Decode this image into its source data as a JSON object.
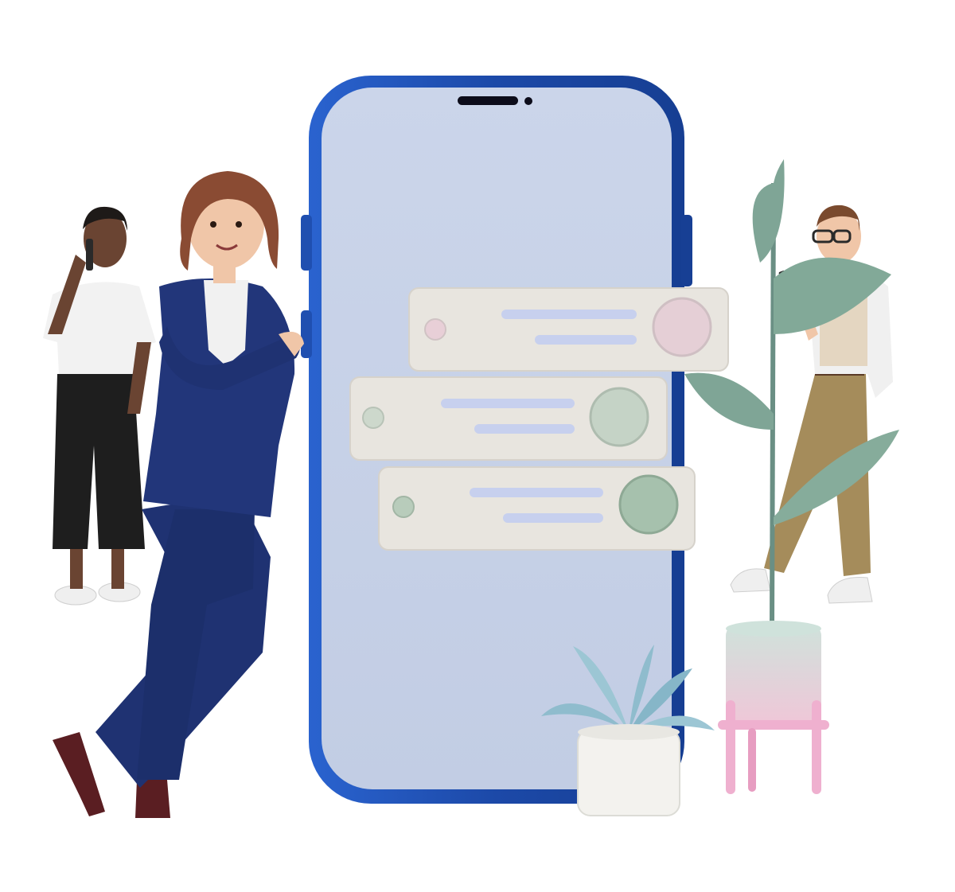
{
  "scene": {
    "description_items": [
      "phone",
      "message-cards",
      "woman-in-suit",
      "person-on-phone",
      "man-with-glasses",
      "tall-plant",
      "small-plant"
    ]
  },
  "colors": {
    "phone_frame": "#1f4fb0",
    "phone_frame_light": "#3c7ee0",
    "phone_screen": "#c8d1e6",
    "card": "#e9e6e0",
    "card_line": "#c9d2ef",
    "dot_pink": "#e6cfd6",
    "dot_sage": "#c7d3c6",
    "dot_green": "#a9c2b0",
    "suit": "#1e3170",
    "hair_brown": "#8a4b33",
    "skin_light": "#f0c6a8",
    "skin_dark": "#6a4432",
    "pant_black": "#1e1e1e",
    "pant_khaki": "#a08a5a",
    "vest": "#e7dccd",
    "leaf": "#7fa596",
    "pot_pink": "#f0c9d9",
    "pot_mint": "#cfe0da",
    "small_leaf": "#8fbccd",
    "small_pot": "#f1f1ee"
  }
}
